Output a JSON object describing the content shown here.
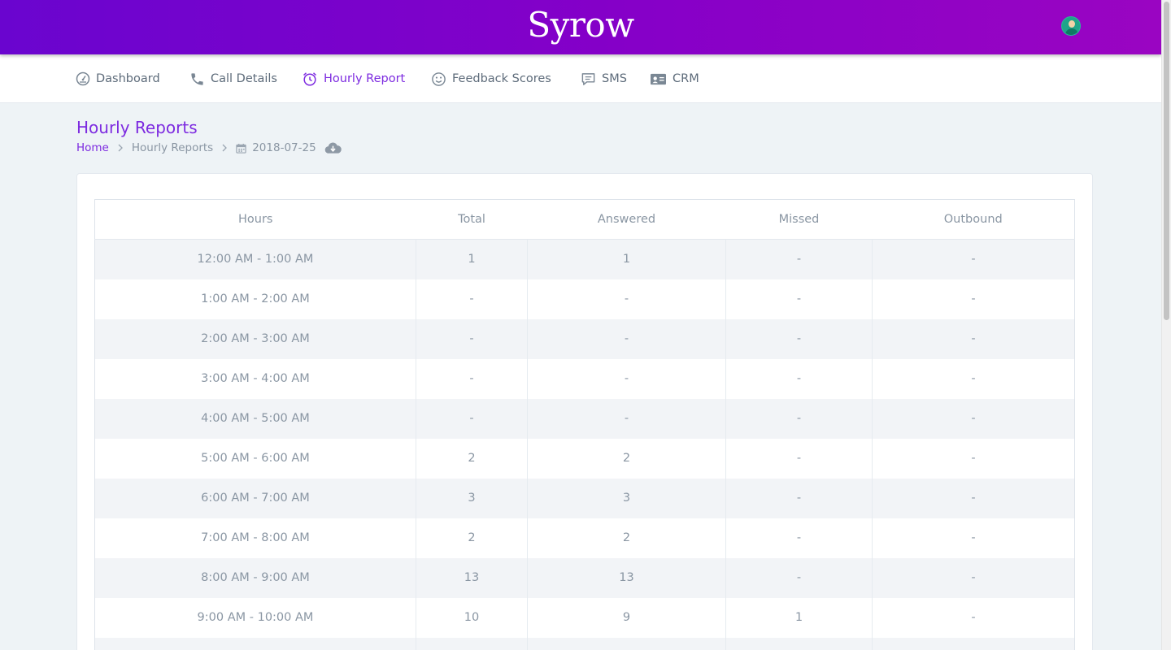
{
  "app": {
    "brand": "Syrow",
    "avatar_icon": "user-avatar-icon",
    "accent_color": "#7d2be0",
    "header_gradient": [
      "#6a05cf",
      "#9a05c2"
    ]
  },
  "nav": {
    "items": [
      {
        "label": "Dashboard",
        "icon": "dashboard-icon"
      },
      {
        "label": "Call Details",
        "icon": "phone-icon"
      },
      {
        "label": "Hourly Report",
        "icon": "alarm-clock-icon",
        "active": true
      },
      {
        "label": "Feedback Scores",
        "icon": "smiley-icon"
      },
      {
        "label": "SMS",
        "icon": "message-icon"
      },
      {
        "label": "CRM",
        "icon": "contact-card-icon"
      }
    ]
  },
  "page": {
    "title": "Hourly Reports",
    "breadcrumb": {
      "home": "Home",
      "current": "Hourly Reports",
      "date": "2018-07-25",
      "date_icon": "calendar-icon",
      "download_icon": "cloud-download-icon"
    }
  },
  "table": {
    "headers": [
      "Hours",
      "Total",
      "Answered",
      "Missed",
      "Outbound"
    ],
    "rows": [
      [
        "12:00 AM - 1:00 AM",
        "1",
        "1",
        "-",
        "-"
      ],
      [
        "1:00 AM - 2:00 AM",
        "-",
        "-",
        "-",
        "-"
      ],
      [
        "2:00 AM - 3:00 AM",
        "-",
        "-",
        "-",
        "-"
      ],
      [
        "3:00 AM - 4:00 AM",
        "-",
        "-",
        "-",
        "-"
      ],
      [
        "4:00 AM - 5:00 AM",
        "-",
        "-",
        "-",
        "-"
      ],
      [
        "5:00 AM - 6:00 AM",
        "2",
        "2",
        "-",
        "-"
      ],
      [
        "6:00 AM - 7:00 AM",
        "3",
        "3",
        "-",
        "-"
      ],
      [
        "7:00 AM - 8:00 AM",
        "2",
        "2",
        "-",
        "-"
      ],
      [
        "8:00 AM - 9:00 AM",
        "13",
        "13",
        "-",
        "-"
      ],
      [
        "9:00 AM - 10:00 AM",
        "10",
        "9",
        "1",
        "-"
      ]
    ]
  }
}
